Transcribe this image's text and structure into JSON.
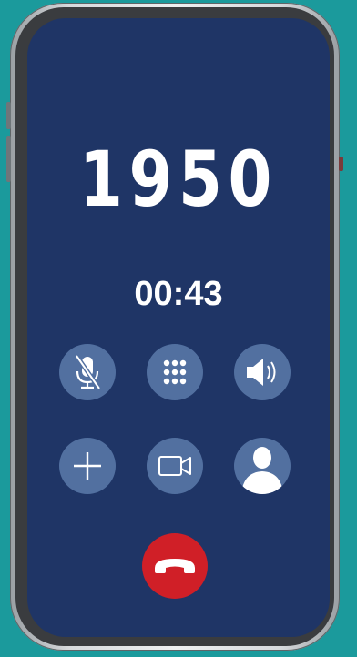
{
  "call": {
    "caller_number": "1950",
    "duration": "00:43"
  },
  "buttons": [
    {
      "id": "mute",
      "icon": "microphone-muted-icon"
    },
    {
      "id": "keypad",
      "icon": "dialpad-icon"
    },
    {
      "id": "speaker",
      "icon": "speaker-icon"
    },
    {
      "id": "add-call",
      "icon": "plus-icon"
    },
    {
      "id": "video",
      "icon": "video-camera-icon"
    },
    {
      "id": "contacts",
      "icon": "contact-person-icon"
    },
    {
      "id": "end-call",
      "icon": "hang-up-icon"
    }
  ],
  "colors": {
    "background": "#1b9a9c",
    "screen": "#1f3566",
    "button": "#5270a0",
    "end_call": "#d01f27",
    "text": "#ffffff"
  }
}
